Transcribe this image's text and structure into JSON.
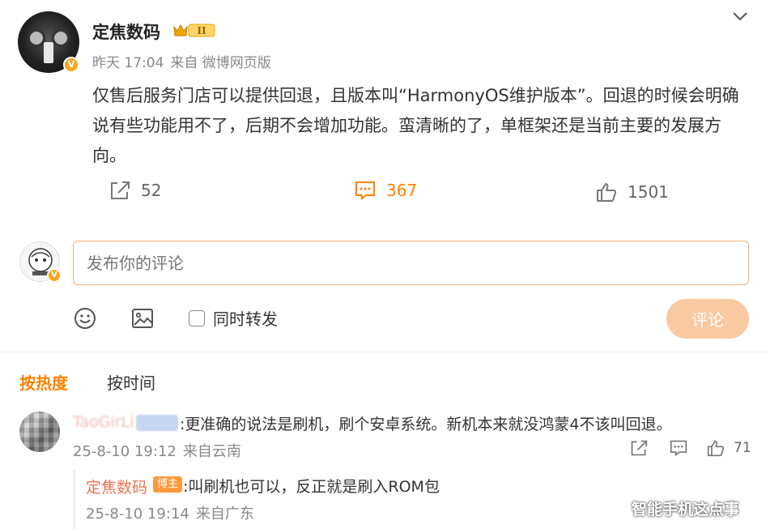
{
  "post": {
    "author": "定焦数码",
    "rank_badge": "II",
    "verified_mark": "V",
    "time": "昨天 17:04",
    "source": "来自 微博网页版",
    "content": "仅售后服务门店可以提供回退，且版本叫“HarmonyOS维护版本”。回退的时候会明确说有些功能用不了，后期不会增加功能。蛮清晰的了，单框架还是当前主要的发展方向。",
    "reposts": "52",
    "comments": "367",
    "likes": "1501"
  },
  "composer": {
    "placeholder": "发布你的评论",
    "repost_label": "同时转发",
    "submit_label": "评论"
  },
  "sort": {
    "hot": "按热度",
    "time": "按时间"
  },
  "comments": [
    {
      "user": "TaoGirLi",
      "text": ":更准确的说法是刷机，刷个安卓系统。新机本来就没鸿蒙4不该叫回退。",
      "date": "25-8-10 19:12",
      "location": "来自云南",
      "likes": "71"
    }
  ],
  "replies": [
    {
      "user": "定焦数码",
      "badge": "博主",
      "text": ":叫刷机也可以，反正就是刷入ROM包",
      "date": "25-8-10 19:14",
      "location": "来自广东"
    }
  ],
  "watermark": "智能手机这点事",
  "colors": {
    "accent": "#ff8200",
    "submit_disabled": "#f9c9a2",
    "input_border": "#f3b17a",
    "verified": "#f5a623",
    "author_name": "#eb7350"
  },
  "icons": [
    "chevron-down-icon",
    "share-icon",
    "comment-icon",
    "like-icon",
    "emoji-icon",
    "image-icon"
  ]
}
